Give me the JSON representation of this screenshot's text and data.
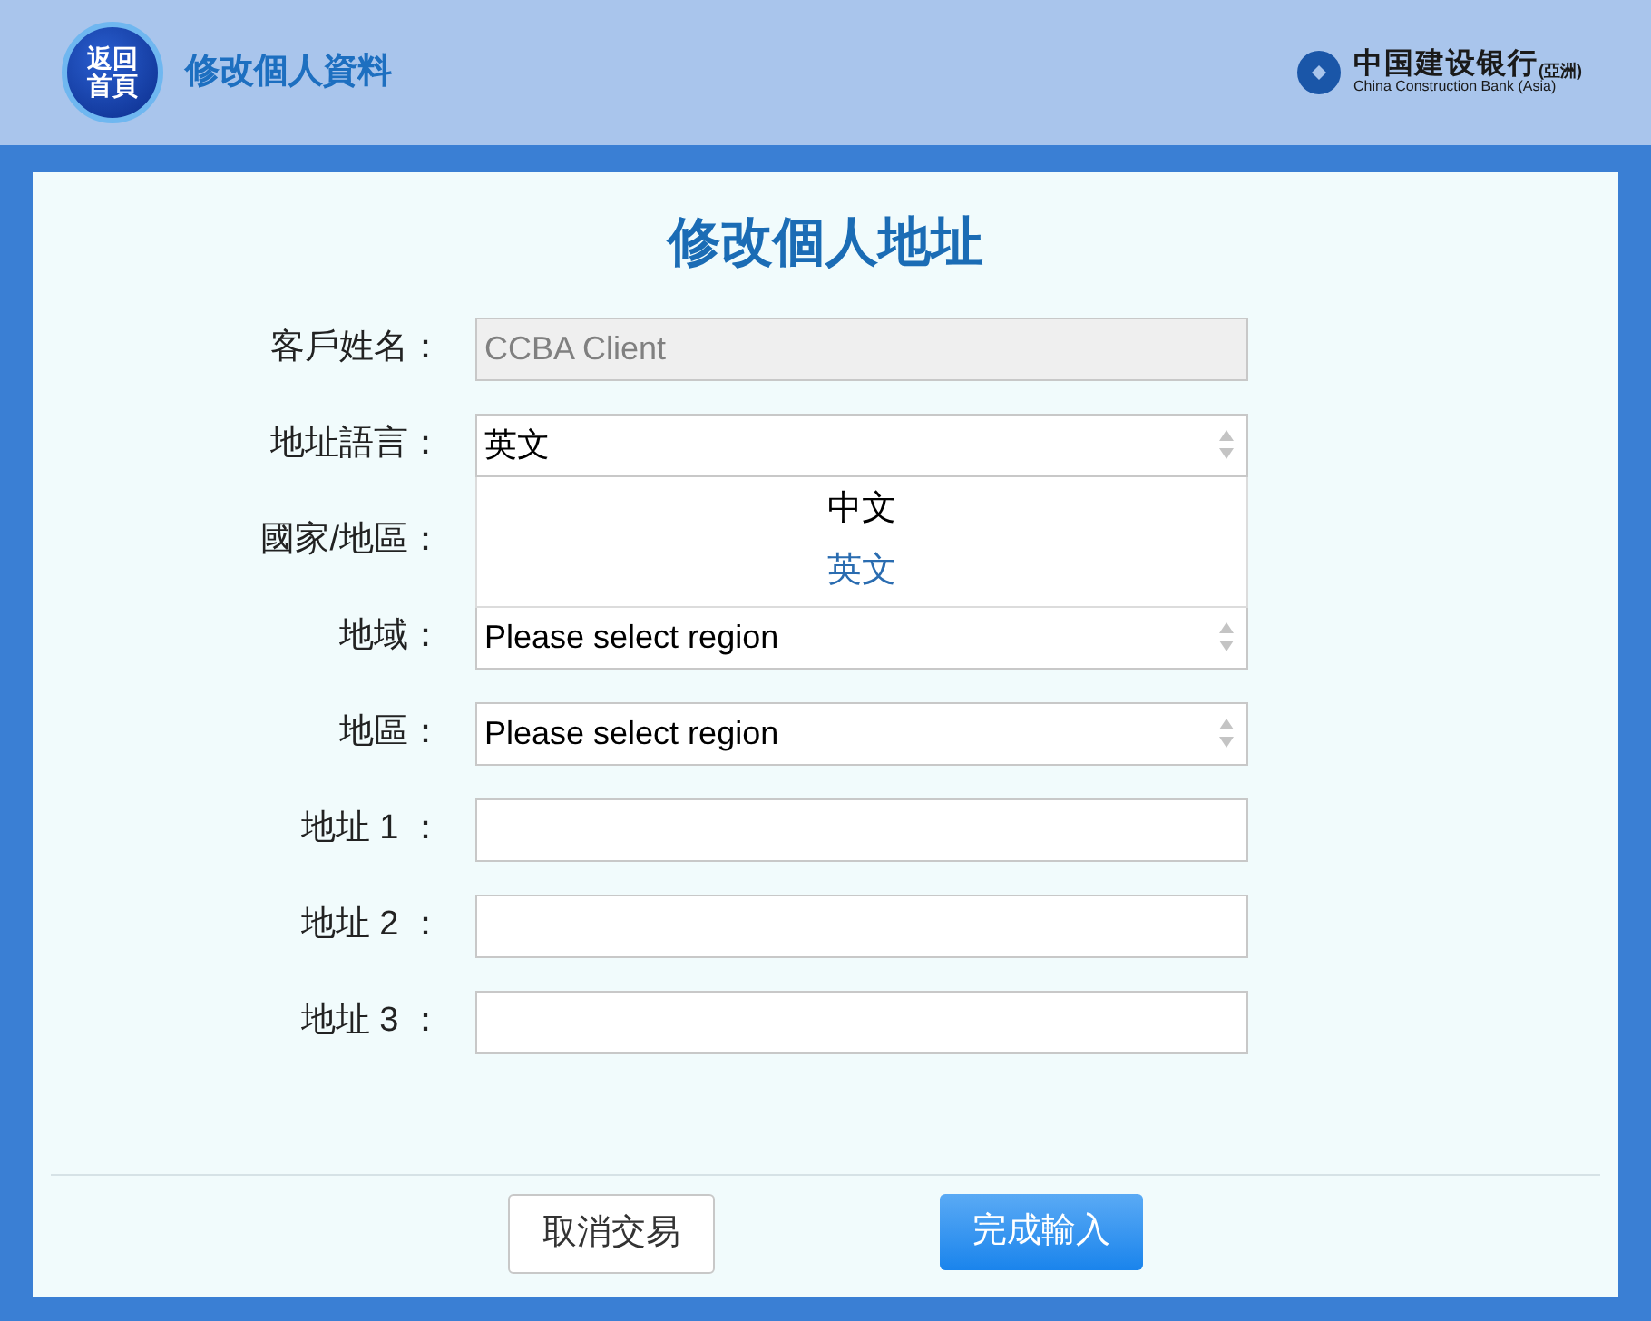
{
  "header": {
    "home_button": [
      "返回",
      "首頁"
    ],
    "title": "修改個人資料",
    "logo": {
      "name_zh": "中国建设银行",
      "suffix": "(亞洲)",
      "name_en": "China Construction Bank (Asia)"
    }
  },
  "form": {
    "title": "修改個人地址",
    "fields": [
      {
        "label": "客戶姓名：",
        "kind": "text",
        "value": "CCBA Client",
        "disabled": true
      },
      {
        "label": "地址語言：",
        "kind": "select",
        "value": "英文",
        "expanded": true,
        "options": [
          {
            "label": "中文",
            "selected": false
          },
          {
            "label": "英文",
            "selected": true
          }
        ]
      },
      {
        "label": "國家/地區：",
        "kind": "hidden"
      },
      {
        "label": "地域：",
        "kind": "select",
        "value": "Please select region",
        "expanded": false
      },
      {
        "label": "地區：",
        "kind": "select",
        "value": "Please select region",
        "expanded": false
      },
      {
        "label": "地址 1 ：",
        "kind": "text",
        "disabled": false
      },
      {
        "label": "地址 2 ：",
        "kind": "text",
        "disabled": false
      },
      {
        "label": "地址 3 ：",
        "kind": "text",
        "disabled": false
      }
    ]
  },
  "buttons": [
    {
      "label": "取消交易",
      "kind": "secondary"
    },
    {
      "label": "完成輸入",
      "kind": "primary"
    }
  ]
}
